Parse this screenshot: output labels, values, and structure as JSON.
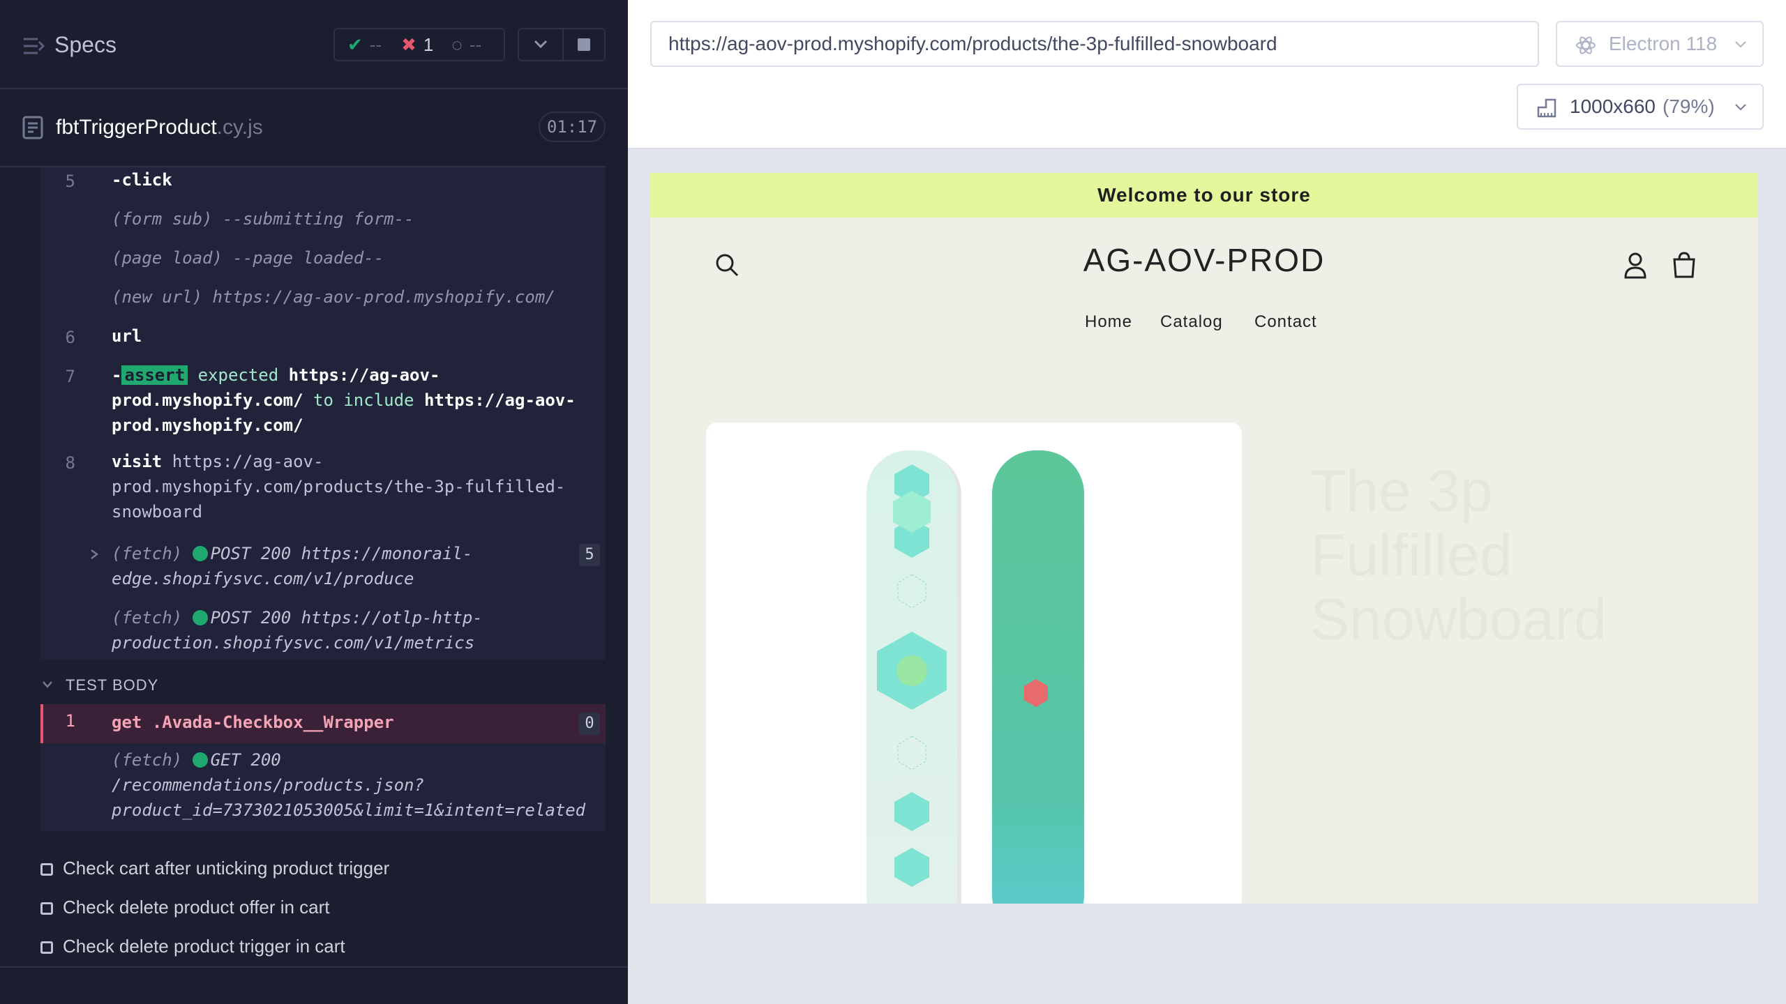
{
  "runner": {
    "specs_label": "Specs",
    "stats": {
      "passed": "--",
      "failed": "1",
      "pending": "--"
    },
    "file": {
      "name": "fbtTriggerProduct",
      "ext": ".cy.js",
      "timer": "01:17"
    },
    "commands": [
      {
        "num": "5",
        "name": "-click"
      },
      {
        "num": "",
        "name": "(form sub)",
        "message": "--submitting form--"
      },
      {
        "num": "",
        "name": "(page load)",
        "message": "--page loaded--"
      },
      {
        "num": "",
        "name": "(new url)",
        "message": "https://ag-aov-prod.myshopify.com/"
      },
      {
        "num": "6",
        "name": "url"
      },
      {
        "num": "7",
        "prefix": "-",
        "badge": "assert",
        "expected": "expected",
        "url1a": "https://ag-aov-",
        "url1b": "prod.myshopify.com/",
        "to_include": "to include",
        "url2a": "https://ag-aov-",
        "url2b": "prod.myshopify.com/"
      },
      {
        "num": "8",
        "name": "visit",
        "line1": "https://ag-aov-",
        "line2": "prod.myshopify.com/products/the-3p-fulfilled-",
        "line3": "snowboard"
      },
      {
        "num": "",
        "name": "(fetch)",
        "line1": "POST 200 https://monorail-",
        "line2": "edge.shopifysvc.com/v1/produce",
        "count": "5"
      },
      {
        "num": "",
        "name": "(fetch)",
        "line1": "POST 200 https://otlp-http-",
        "line2": "production.shopifysvc.com/v1/metrics"
      }
    ],
    "test_body_label": "TEST BODY",
    "active_cmd": {
      "num": "1",
      "name": "get",
      "selector": ".Avada-Checkbox__Wrapper",
      "count": "0"
    },
    "fetch3": {
      "name": "(fetch)",
      "line1": "GET 200",
      "line2": "/recommendations/products.json?",
      "line3": "product_id=7373021053005&limit=1&intent=related"
    },
    "tests": [
      "Check cart after unticking product trigger",
      "Check delete product offer in cart",
      "Check delete product trigger in cart"
    ]
  },
  "browser": {
    "url": "https://ag-aov-prod.myshopify.com/products/the-3p-fulfilled-snowboard",
    "browser_name": "Electron 118",
    "viewport": "1000x660",
    "zoom": "(79%)"
  },
  "store": {
    "announcement": "Welcome to our store",
    "logo": "AG-AOV-PROD",
    "nav": [
      "Home",
      "Catalog",
      "Contact"
    ],
    "product_title": "The 3p Fulfilled Snowboard"
  }
}
